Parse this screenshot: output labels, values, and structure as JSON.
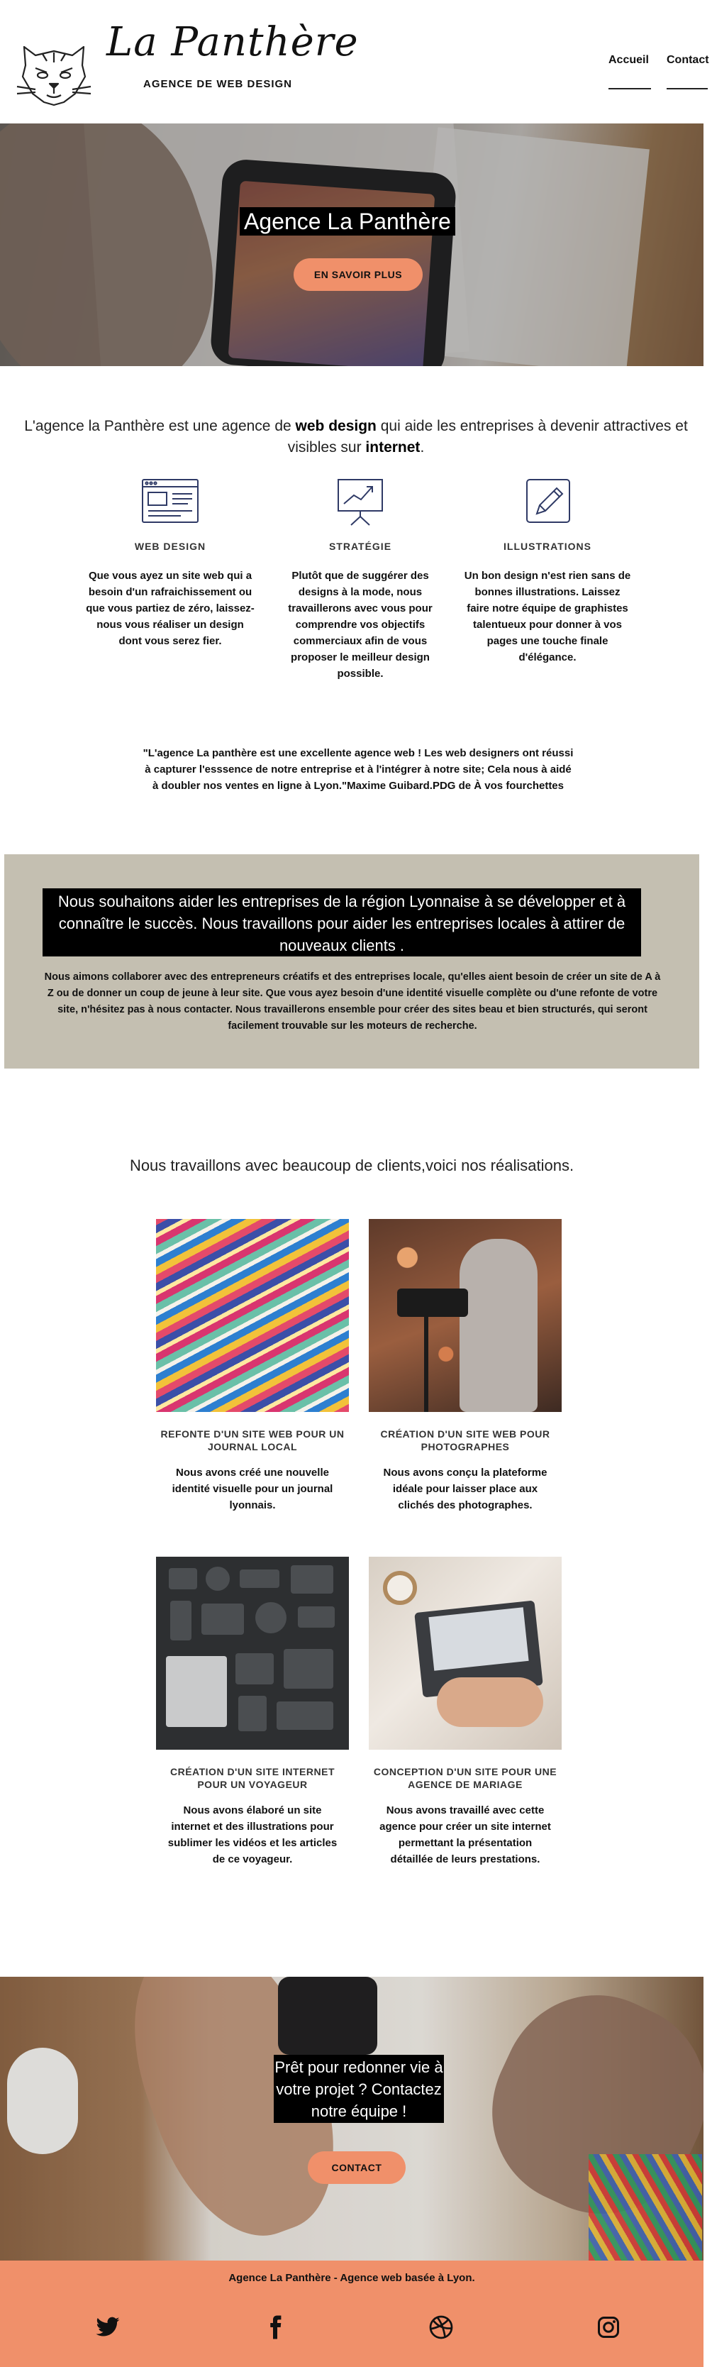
{
  "header": {
    "brand": "La Panthère",
    "tagline": "AGENCE DE WEB DESIGN",
    "nav": [
      {
        "label": "Accueil"
      },
      {
        "label": "Contact"
      }
    ]
  },
  "hero": {
    "title": "Agence La Panthère",
    "button": "EN SAVOIR PLUS"
  },
  "intro": {
    "part1": "L'agence la Panthère est une agence de ",
    "bold1": "web design",
    "part2": " qui aide les entreprises à devenir attractives et visibles sur ",
    "bold2": "internet",
    "part3": "."
  },
  "services": [
    {
      "icon": "browser-layout-icon",
      "title": "WEB DESIGN",
      "text": "Que vous ayez un site web qui a besoin d'un rafraichissement ou que vous partiez de zéro, laissez-nous vous réaliser un design dont vous serez fier."
    },
    {
      "icon": "chart-board-icon",
      "title": "STRATÉGIE",
      "text": "Plutôt que de suggérer des designs à la mode, nous travaillerons avec vous pour comprendre vos objectifs commerciaux afin de vous proposer le meilleur design possible."
    },
    {
      "icon": "pencil-edit-icon",
      "title": "ILLUSTRATIONS",
      "text": "Un bon design n'est rien sans de bonnes illustrations. Laissez faire notre équipe de graphistes talentueux pour donner à vos pages une touche finale d'élégance."
    }
  ],
  "testimonial": "\"L'agence La panthère est une excellente agence web ! Les web designers ont réussi à capturer l'esssence de notre entreprise et à l'intégrer à notre site; Cela nous à aidé à doubler nos ventes en ligne à Lyon.\"Maxime Guibard.PDG de À vos fourchettes",
  "mission": {
    "heading": "Nous souhaitons aider les entreprises de la région Lyonnaise à se développer et à connaître le succès. Nous travaillons pour aider les entreprises locales à attirer de nouveaux clients .",
    "text": "Nous aimons collaborer avec des entrepreneurs créatifs et des entreprises locale, qu'elles aient besoin de créer un site de A à Z ou de donner un coup de jeune à leur site. Que vous ayez besoin d'une identité visuelle complète ou d'une refonte de votre site, n'hésitez pas à nous contacter. Nous travaillerons ensemble pour créer des sites beau et bien structurés, qui seront facilement trouvable sur les moteurs de recherche."
  },
  "works": {
    "title": "Nous travaillons avec beaucoup de clients,voici nos réalisations.",
    "items": [
      {
        "title": "REFONTE D'UN SITE WEB POUR UN JOURNAL LOCAL",
        "text": "Nous avons créé une nouvelle identité visuelle pour un journal lyonnais."
      },
      {
        "title": "CRÉATION D'UN SITE WEB POUR PHOTOGRAPHES",
        "text": "Nous avons conçu la plateforme idéale pour laisser place aux clichés des photographes."
      },
      {
        "title": "CRÉATION D'UN SITE INTERNET POUR UN VOYAGEUR",
        "text": "Nous avons élaboré un site internet et des illustrations pour sublimer les vidéos et les articles de ce voyageur."
      },
      {
        "title": "CONCEPTION D'UN SITE POUR UNE AGENCE DE MARIAGE",
        "text": "Nous avons travaillé avec cette agence pour créer un site internet permettant la présentation détaillée de leurs prestations."
      }
    ]
  },
  "cta": {
    "title": "Prêt pour redonner vie à votre projet ? Contactez notre équipe !",
    "button": "CONTACT"
  },
  "footer": {
    "text": "Agence La Panthère - Agence web basée à Lyon.",
    "social": [
      "twitter-icon",
      "facebook-icon",
      "dribbble-icon",
      "instagram-icon"
    ]
  },
  "colors": {
    "accent": "#f0906a",
    "band": "#c4bfb1"
  }
}
